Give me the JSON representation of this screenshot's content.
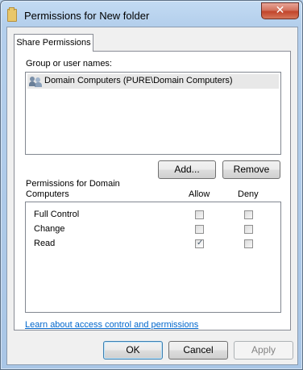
{
  "window": {
    "title": "Permissions for New folder",
    "close_glyph": "✕",
    "icon": "folder-icon"
  },
  "tabs": [
    {
      "label": "Share Permissions",
      "selected": true
    }
  ],
  "group_section": {
    "label": "Group or user names:",
    "entries": [
      {
        "icon": "users-icon",
        "name": "Domain Computers (PURE\\Domain Computers)",
        "selected": true
      }
    ]
  },
  "buttons": {
    "add": "Add...",
    "remove": "Remove",
    "ok": "OK",
    "cancel": "Cancel",
    "apply": "Apply"
  },
  "permissions": {
    "label_line1": "Permissions for Domain",
    "label_line2": "Computers",
    "allow_header": "Allow",
    "deny_header": "Deny",
    "rows": [
      {
        "name": "Full Control",
        "allow": false,
        "deny": false
      },
      {
        "name": "Change",
        "allow": false,
        "deny": false
      },
      {
        "name": "Read",
        "allow": true,
        "deny": false
      }
    ]
  },
  "help_link": "Learn about access control and permissions",
  "colors": {
    "link": "#0066cc",
    "close_button": "#c2452b",
    "selection": "#e8e8e8"
  }
}
